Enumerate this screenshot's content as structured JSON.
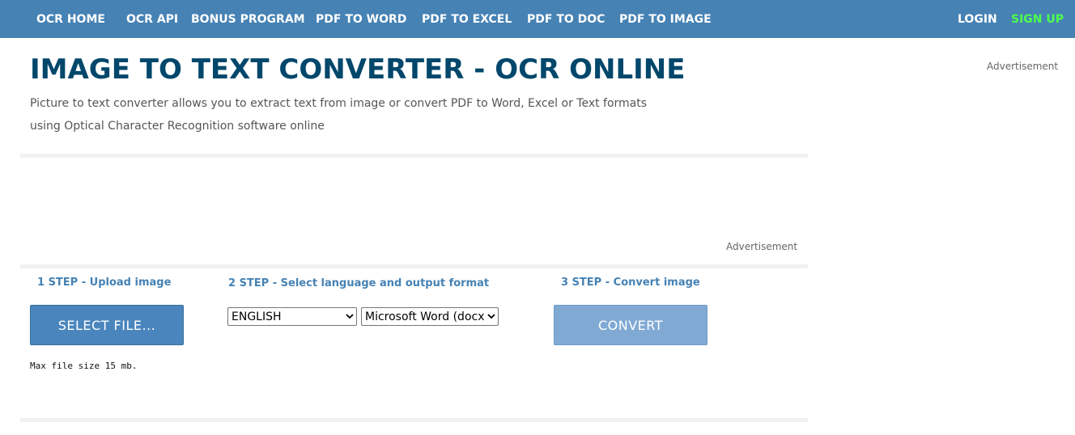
{
  "nav": {
    "items": [
      {
        "label": "OCR HOME"
      },
      {
        "label": "OCR API"
      },
      {
        "label": "BONUS PROGRAM"
      },
      {
        "label": "PDF TO WORD"
      },
      {
        "label": "PDF TO EXCEL"
      },
      {
        "label": "PDF TO DOC"
      },
      {
        "label": "PDF TO IMAGE"
      }
    ],
    "login": "LOGIN",
    "signup": "SIGN UP",
    "colors": {
      "bar": "#4682b4",
      "signup": "#4cff4c"
    }
  },
  "header": {
    "title": "IMAGE TO TEXT CONVERTER - OCR ONLINE",
    "subtitle": "Picture to text converter allows you to extract text from image or convert PDF to Word, Excel or Text formats using Optical Character Recognition software online"
  },
  "ads": {
    "sidebar_label": "Advertisement",
    "banner_label": "Advertisement"
  },
  "steps": {
    "step1": {
      "label": "1 STEP - Upload image",
      "button": "SELECT FILE...",
      "note": "Max file size 15 mb."
    },
    "step2": {
      "label": "2 STEP - Select language and output format",
      "language_selected": "ENGLISH",
      "format_selected": "Microsoft Word (docx)"
    },
    "step3": {
      "label": "3 STEP - Convert image",
      "button": "CONVERT"
    }
  },
  "icons": {
    "dropdown": "chevron-down-icon"
  }
}
